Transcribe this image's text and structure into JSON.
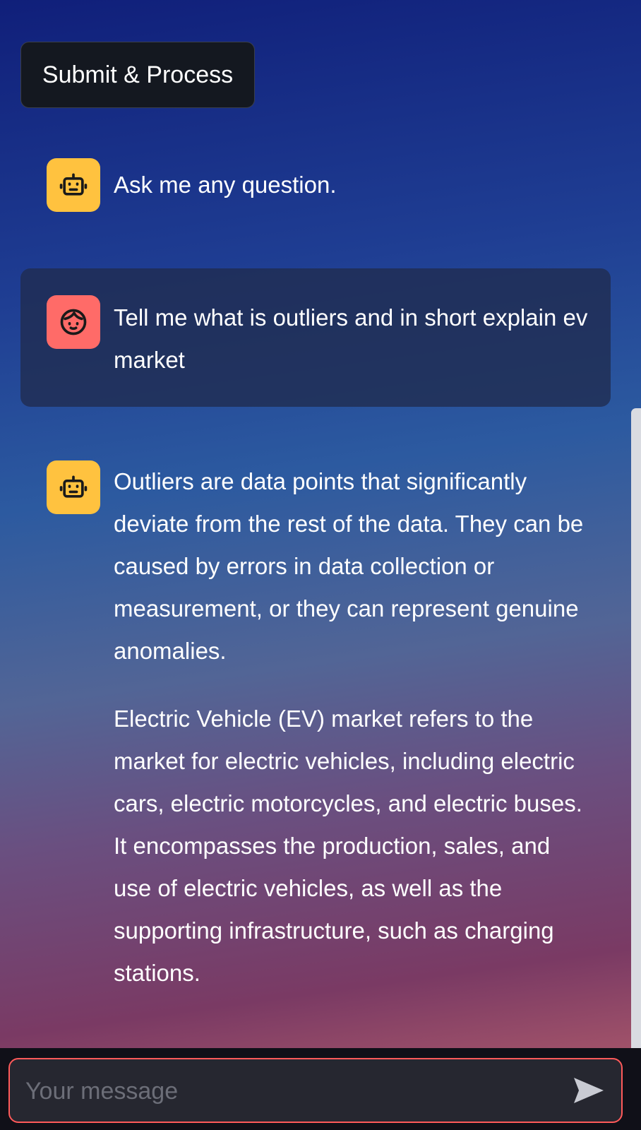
{
  "toolbar": {
    "submit_label": "Submit & Process"
  },
  "chat": {
    "messages": [
      {
        "role": "assistant",
        "avatar_icon": "robot-icon",
        "paragraphs": [
          "Ask me any question."
        ]
      },
      {
        "role": "user",
        "avatar_icon": "user-face-icon",
        "paragraphs": [
          "Tell me what is outliers and in short explain ev market"
        ]
      },
      {
        "role": "assistant",
        "avatar_icon": "robot-icon",
        "paragraphs": [
          "Outliers are data points that significantly deviate from the rest of the data. They can be caused by errors in data collection or measurement, or they can represent genuine anomalies.",
          "Electric Vehicle (EV) market refers to the market for electric vehicles, including electric cars, electric motorcycles, and electric buses. It encompasses the production, sales, and use of electric vehicles, as well as the supporting infrastructure, such as charging stations."
        ]
      }
    ]
  },
  "input": {
    "placeholder": "Your message",
    "value": "",
    "send_icon": "send-icon"
  },
  "colors": {
    "bot_avatar": "#ffc23f",
    "user_avatar": "#ff6b68",
    "input_border": "#ff5a5a",
    "button_bg": "#141820"
  }
}
